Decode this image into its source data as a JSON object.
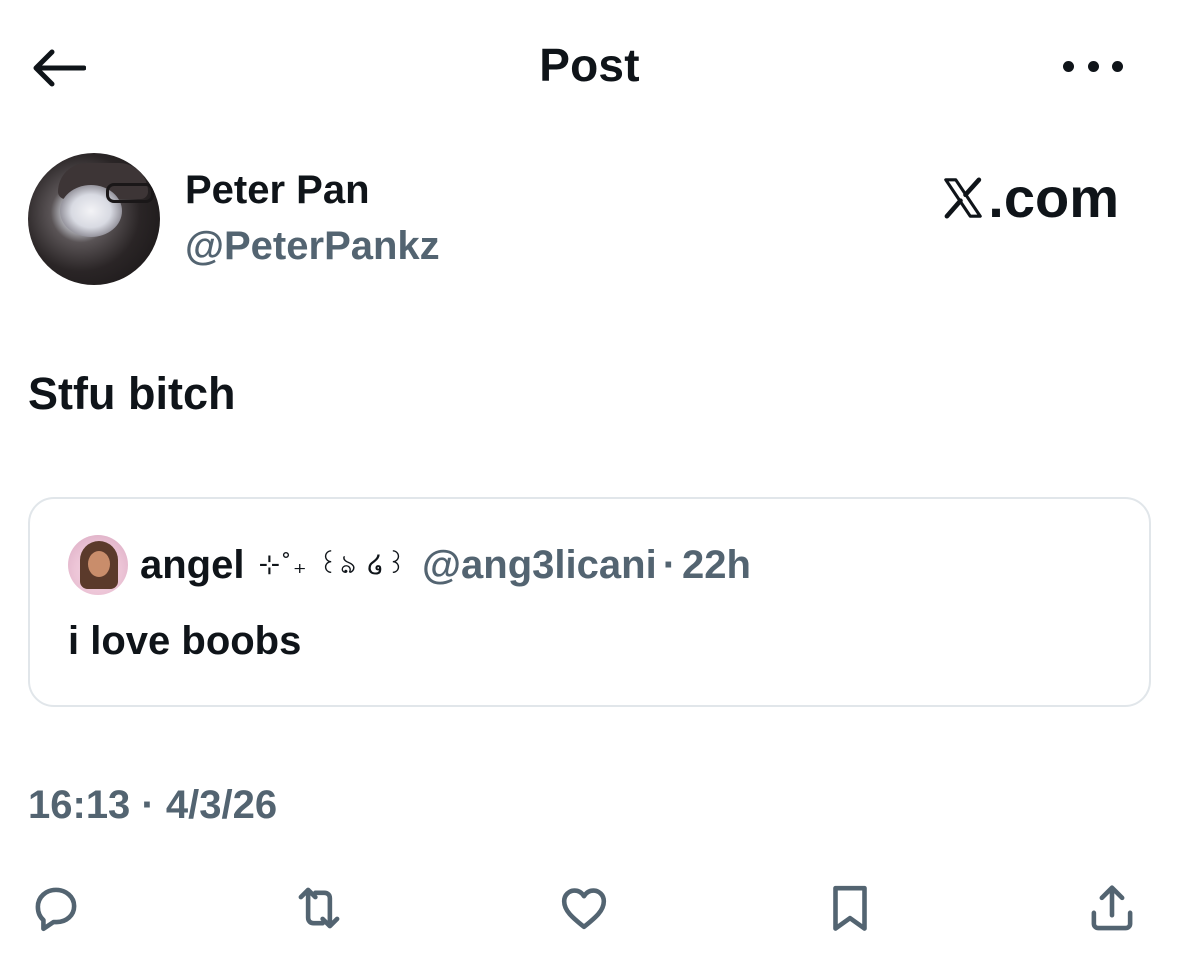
{
  "header": {
    "title": "Post",
    "back_icon": "arrow-left-icon",
    "more_icon": "more-horizontal-icon"
  },
  "author": {
    "name": "Peter Pan",
    "handle": "@PeterPankz"
  },
  "watermark": {
    "text": ".com",
    "logo": "x-logo-icon"
  },
  "post": {
    "text": "Stfu bitch"
  },
  "quote": {
    "name": "angel",
    "decoration": "⊹˚₊ ꒰ঌ ໒꒱",
    "handle": "@ang3licani",
    "separator": "·",
    "time": "22h",
    "text": "i love boobs"
  },
  "meta": {
    "text": "16:13 · 4/3/26"
  },
  "actions": [
    "reply-icon",
    "repost-icon",
    "like-icon",
    "bookmark-icon",
    "share-icon"
  ],
  "colors": {
    "text": "#0f1419",
    "secondary": "#536471",
    "border": "#e1e6ea",
    "background": "#ffffff"
  }
}
